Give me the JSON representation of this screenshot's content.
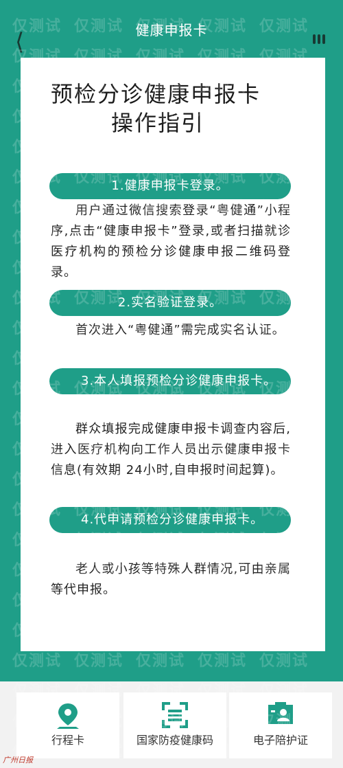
{
  "header": {
    "title": "健康申报卡"
  },
  "guide": {
    "title_line1": "预检分诊健康申报卡",
    "title_line2": "操作指引",
    "steps": [
      {
        "heading": "1.健康申报卡登录。",
        "body": "用户通过微信搜索登录“粤健通”小程序,点击“健康申报卡”登录,或者扫描就诊医疗机构的预检分诊健康申报二维码登录。"
      },
      {
        "heading": "2.实名验证登录。",
        "body": "首次进入“粤健通”需完成实名认证。"
      },
      {
        "heading": "3.本人填报预检分诊健康申报卡。",
        "body": "群众填报完成健康申报卡调查内容后,进入医疗机构向工作人员出示健康申报卡信息(有效期 24小时,自申报时间起算)。"
      },
      {
        "heading": "4.代申请预检分诊健康申报卡。",
        "body": "老人或小孩等特殊人群情况,可由亲属等代申报。"
      }
    ]
  },
  "tabs": [
    {
      "label": "行程卡",
      "icon": "location-pin-icon"
    },
    {
      "label": "国家防疫健康码",
      "icon": "qr-scan-icon"
    },
    {
      "label": "电子陪护证",
      "icon": "id-card-icon"
    }
  ],
  "watermark": "仅测试",
  "brand": "广州日报",
  "colors": {
    "accent": "#1f9e88",
    "text": "#222222"
  }
}
